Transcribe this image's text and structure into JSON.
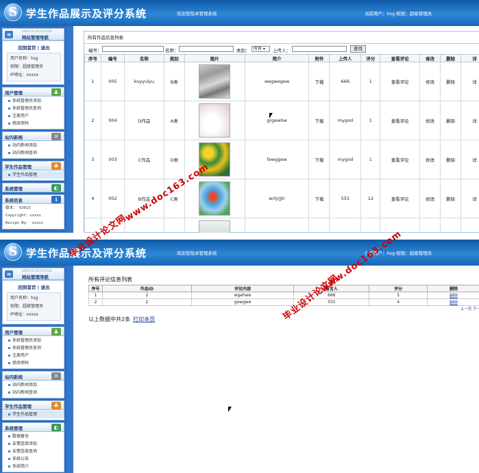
{
  "app": {
    "title": "学生作品展示及评分系统",
    "welcome": "欢迎登陆本管理系统",
    "user_info": "当前用户：hsg 权限：超级管理员"
  },
  "sidebar": {
    "nav_subtitle": "WEBSITE NAVIGATION",
    "nav_title": "网站管理导航",
    "links": "回到首页 | 退出",
    "user_name": "用户名称：hsg",
    "user_role": "权限：超级管理员",
    "user_ip": "IP地址：xxxxx",
    "sections": [
      {
        "title": "用户管理",
        "items": [
          "系统管理员添加",
          "系统管理员查询",
          "注册用户",
          "修改密码"
        ]
      },
      {
        "title": "站内新闻",
        "items": [
          "站内新闻添加",
          "站内新闻查询"
        ]
      },
      {
        "title": "学生作品管理",
        "items": [
          "学生作品管理"
        ]
      },
      {
        "title": "系统管理",
        "items": [
          "数据备份",
          "友情连接添加",
          "友情连接查询",
          "系统公告",
          "系统简介"
        ]
      },
      {
        "title": "系统信息",
        "items": [
          "版本： V2013",
          "Copyright：xxxxx",
          "Design By： xxxxx"
        ]
      }
    ]
  },
  "works": {
    "title": "所有作品信息列表",
    "search": {
      "no_label": "编号：",
      "name_label": "名称：",
      "category_label": "类别：",
      "category_value": "所有",
      "uploader_label": "上传人：",
      "button": "查找"
    },
    "columns": [
      "序号",
      "编号",
      "名称",
      "类别",
      "图片",
      "简介",
      "附件",
      "上传人",
      "评分",
      "查看评论",
      "修改",
      "删除",
      "详"
    ],
    "rows": [
      {
        "seq": "1",
        "no": "005",
        "name": "kuyyulyu",
        "cat": "B类",
        "intro": "wegwegew",
        "file": "下载",
        "uploader": "666",
        "score": "1",
        "view": "查看评论",
        "edit": "修改",
        "del": "删除",
        "detail": "详"
      },
      {
        "seq": "2",
        "no": "004",
        "name": "D作品",
        "cat": "A类",
        "intro": "grgewhw",
        "file": "下载",
        "uploader": "mygod",
        "score": "1",
        "view": "查看评论",
        "edit": "修改",
        "del": "删除",
        "detail": "详"
      },
      {
        "seq": "3",
        "no": "003",
        "name": "C作品",
        "cat": "D类",
        "intro": "fewggew",
        "file": "下载",
        "uploader": "mygod",
        "score": "1",
        "view": "查看评论",
        "edit": "修改",
        "del": "删除",
        "detail": "详"
      },
      {
        "seq": "4",
        "no": "002",
        "name": "B作品",
        "cat": "C类",
        "intro": "wrtjrjjtr",
        "file": "下载",
        "uploader": "555",
        "score": "12",
        "view": "查看评论",
        "edit": "修改",
        "del": "删除",
        "detail": "详"
      }
    ]
  },
  "reviews": {
    "title": "所有评论信息列表",
    "columns": [
      "序号",
      "作品ID",
      "评论内容",
      "留言人",
      "评分",
      "删除"
    ],
    "rows": [
      {
        "seq": "1",
        "id": "2",
        "content": "wgehwe",
        "author": "666",
        "score": "5",
        "del": "删除"
      },
      {
        "seq": "2",
        "id": "2",
        "content": "gewgwe",
        "author": "555",
        "score": "4",
        "del": "删除"
      }
    ],
    "pager": "上一页  下一",
    "summary": "以上数据中共2条",
    "print": "打印本页"
  },
  "watermarks": [
    "www.doc163.com",
    "毕业设计论文网"
  ],
  "colors": {
    "header": "#2f87d6",
    "sidebar": "#2d6fc2",
    "watermark": "#d00000",
    "link": "#1a3aa0"
  }
}
